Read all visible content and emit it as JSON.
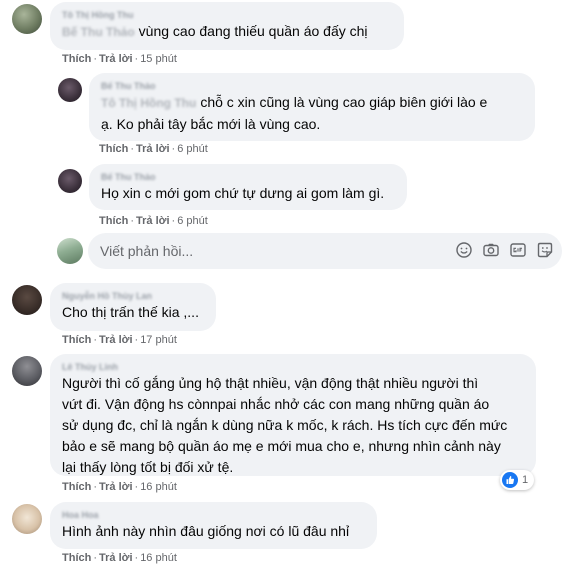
{
  "comments": [
    {
      "author": "Tô Thị Hồng Thu",
      "tag": "Bế Thu Thảo",
      "text": "vùng cao đang thiếu quần áo đấy chị",
      "like": "Thích",
      "reply": "Trả lời",
      "time": "15 phút"
    },
    {
      "author": "Bế Thu Thảo",
      "tag": "Tô Thị Hồng Thu",
      "text_line1": "chỗ c xin cũng là vùng cao giáp biên giới lào e",
      "text_line2": "ạ. Ko phải tây bắc mới là vùng cao.",
      "like": "Thích",
      "reply": "Trả lời",
      "time": "6 phút"
    },
    {
      "author": "Bế Thu Thảo",
      "text": "Họ xin c mới gom chứ tự dưng ai gom làm gì.",
      "like": "Thích",
      "reply": "Trả lời",
      "time": "6 phút"
    },
    {
      "author": "Nguyễn Hồ Thùy Lan",
      "text": "Cho thị trấn thế kia ,...",
      "like": "Thích",
      "reply": "Trả lời",
      "time": "17 phút"
    },
    {
      "author": "Lê Thủy Linh",
      "lines": [
        "Người thì cố gắng ủng hộ thật nhiều, vận động thật nhiều người thì",
        "vứt đi. Vận động hs cònnpai nhắc nhở các con mang những quần áo",
        "sử dụng đc, chỉ là ngắn k dùng nữa k mốc, k rách. Hs tích cực đến mức",
        "bảo e sẽ mang bộ quần áo mẹ e mới mua cho e, nhưng nhìn cảnh này",
        "lại thấy lòng tốt bị đối xử tệ."
      ],
      "like": "Thích",
      "reply": "Trả lời",
      "time": "16 phút",
      "reaction_count": "1"
    },
    {
      "author": "Hoa Hoa",
      "text": "Hình ảnh này nhìn đâu giống nơi có lũ đâu nhỉ",
      "like": "Thích",
      "reply": "Trả lời",
      "time": "16 phút"
    }
  ],
  "reply_box": {
    "placeholder": "Viết phản hồi...",
    "icons": [
      "emoji-icon",
      "camera-icon",
      "gif-icon",
      "sticker-icon"
    ]
  },
  "colors": {
    "bubble": "#f0f2f5",
    "text": "#050505",
    "meta": "#65676b",
    "like_blue": "#1877f2"
  }
}
